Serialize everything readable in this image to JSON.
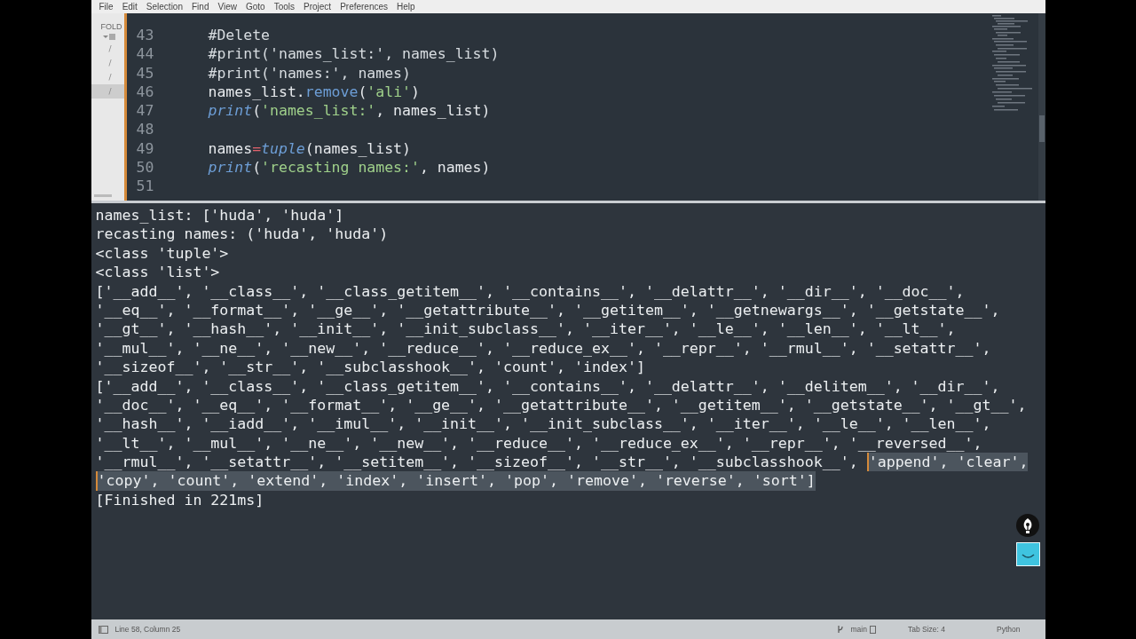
{
  "menu": [
    "File",
    "Edit",
    "Selection",
    "Find",
    "View",
    "Goto",
    "Tools",
    "Project",
    "Preferences",
    "Help"
  ],
  "sidebar": {
    "header": "FOLD",
    "items": [
      {
        "label": "/",
        "selected": false
      },
      {
        "label": "/",
        "selected": false
      },
      {
        "label": "/",
        "selected": false
      },
      {
        "label": "/",
        "selected": true
      }
    ]
  },
  "editor": {
    "lines": [
      {
        "number": "43",
        "tokens": [
          {
            "text": "#Delete",
            "kind": "comment"
          }
        ]
      },
      {
        "number": "44",
        "tokens": [
          {
            "text": "#print('names_list:', names_list)",
            "kind": "comment"
          }
        ]
      },
      {
        "number": "45",
        "tokens": [
          {
            "text": "#print('names:', names)",
            "kind": "comment"
          }
        ]
      },
      {
        "number": "46",
        "tokens": [
          {
            "text": "names_list.",
            "kind": "plain"
          },
          {
            "text": "remove",
            "kind": "method"
          },
          {
            "text": "(",
            "kind": "plain"
          },
          {
            "text": "'ali'",
            "kind": "string"
          },
          {
            "text": ")",
            "kind": "plain"
          }
        ]
      },
      {
        "number": "47",
        "tokens": [
          {
            "text": "print",
            "kind": "builtin"
          },
          {
            "text": "(",
            "kind": "plain"
          },
          {
            "text": "'names_list:'",
            "kind": "string"
          },
          {
            "text": ", names_list)",
            "kind": "plain"
          }
        ]
      },
      {
        "number": "48"
      },
      {
        "number": "49",
        "tokens": [
          {
            "text": "names",
            "kind": "plain"
          },
          {
            "text": "=",
            "kind": "operator"
          },
          {
            "text": "tuple",
            "kind": "builtin"
          },
          {
            "text": "(names_list)",
            "kind": "plain"
          }
        ]
      },
      {
        "number": "50",
        "tokens": [
          {
            "text": "print",
            "kind": "builtin"
          },
          {
            "text": "(",
            "kind": "plain"
          },
          {
            "text": "'recasting names:'",
            "kind": "string"
          },
          {
            "text": ", names)",
            "kind": "plain"
          }
        ]
      },
      {
        "number": "51"
      }
    ]
  },
  "output": {
    "lines": [
      [
        {
          "text": "names_list: ['huda', 'huda']",
          "selected": false
        }
      ],
      [
        {
          "text": "recasting names: ('huda', 'huda')",
          "selected": false
        }
      ],
      [
        {
          "text": "<class 'tuple'>",
          "selected": false
        }
      ],
      [
        {
          "text": "<class 'list'>",
          "selected": false
        }
      ],
      [
        {
          "text": "['__add__', '__class__', '__class_getitem__', '__contains__', '__delattr__', '__dir__', '__doc__',",
          "selected": false
        }
      ],
      [
        {
          "text": "'__eq__', '__format__', '__ge__', '__getattribute__', '__getitem__', '__getnewargs__', '__getstate__',",
          "selected": false
        }
      ],
      [
        {
          "text": "'__gt__', '__hash__', '__init__', '__init_subclass__', '__iter__', '__le__', '__len__', '__lt__',",
          "selected": false
        }
      ],
      [
        {
          "text": "'__mul__', '__ne__', '__new__', '__reduce__', '__reduce_ex__', '__repr__', '__rmul__', '__setattr__',",
          "selected": false
        }
      ],
      [
        {
          "text": "'__sizeof__', '__str__', '__subclasshook__', 'count', 'index']",
          "selected": false
        }
      ],
      [
        {
          "text": "['__add__', '__class__', '__class_getitem__', '__contains__', '__delattr__', '__delitem__', '__dir__',",
          "selected": false
        }
      ],
      [
        {
          "text": "'__doc__', '__eq__', '__format__', '__ge__', '__getattribute__', '__getitem__', '__getstate__', '__gt__',",
          "selected": false
        }
      ],
      [
        {
          "text": "'__hash__', '__iadd__', '__imul__', '__init__', '__init_subclass__', '__iter__', '__le__', '__len__',",
          "selected": false
        }
      ],
      [
        {
          "text": "'__lt__', '__mul__', '__ne__', '__new__', '__reduce__', '__reduce_ex__', '__repr__', '__reversed__',",
          "selected": false
        }
      ],
      [
        {
          "text": "'__rmul__', '__setattr__', '__setitem__', '__sizeof__', '__str__', '__subclasshook__', ",
          "selected": false
        },
        {
          "text": "'append', 'clear',",
          "selected": true
        }
      ],
      [
        {
          "text": "'copy', 'count', 'extend', 'index', 'insert', 'pop', 'remove', 'reverse', 'sort']",
          "selected": true
        }
      ],
      [
        {
          "text": "[Finished in 221ms]",
          "selected": false
        }
      ]
    ]
  },
  "status_bar": {
    "position": "Line 58, Column 25",
    "branch": "main",
    "tab_size": "Tab Size: 4",
    "syntax": "Python"
  }
}
